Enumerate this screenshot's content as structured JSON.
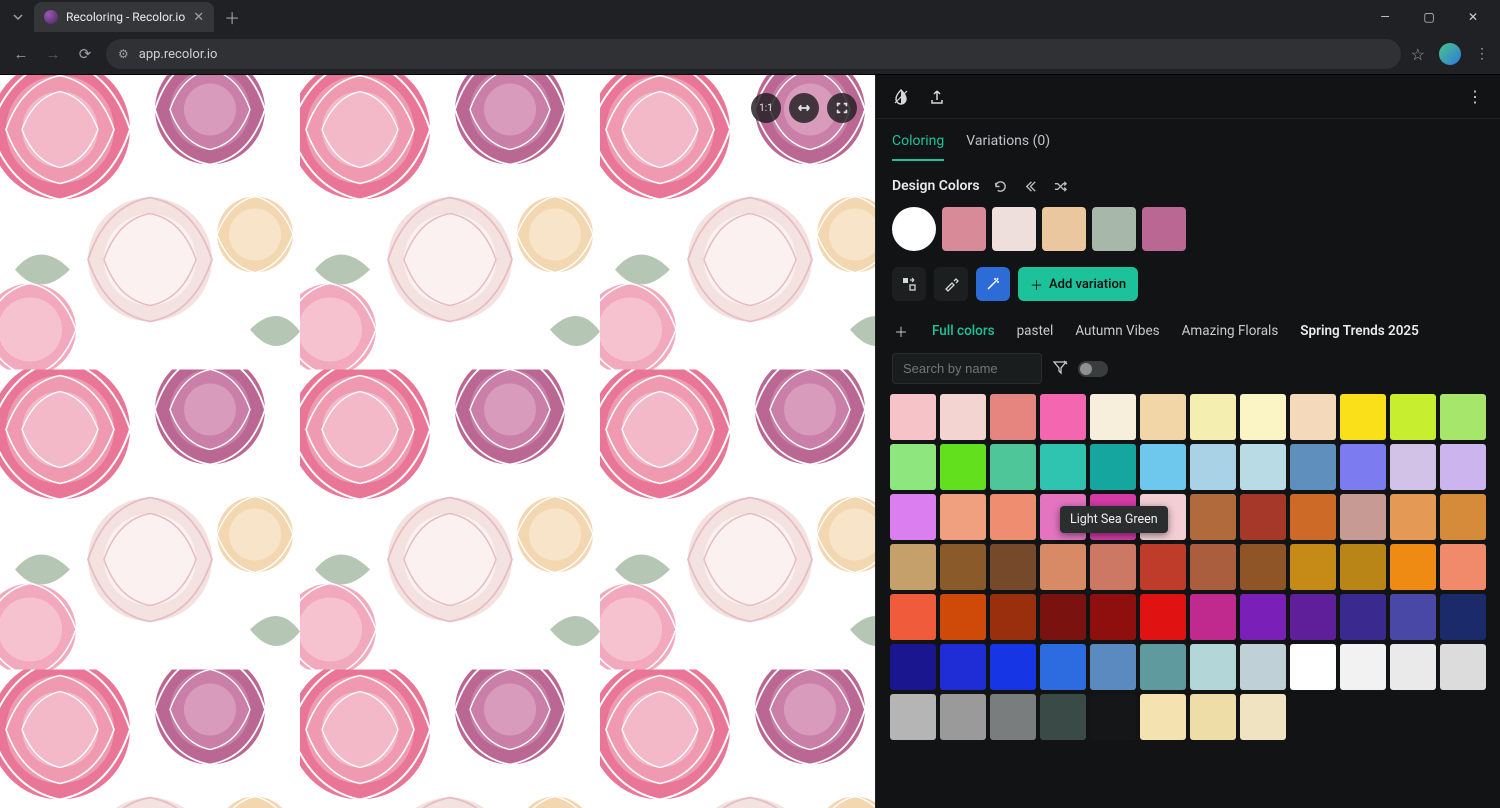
{
  "browser": {
    "tab_title": "Recoloring - Recolor.io",
    "url": "app.recolor.io"
  },
  "canvas": {
    "zoom_label": "1:1"
  },
  "panel": {
    "tabs": {
      "coloring": "Coloring",
      "variations": "Variations (0)"
    },
    "design_colors_title": "Design Colors",
    "design_colors": [
      "#ffffff",
      "#d98a99",
      "#eedfdc",
      "#ebc7a0",
      "#a7b8ab",
      "#bb6794"
    ],
    "add_variation_label": "Add variation",
    "palette_tabs": {
      "full_colors": "Full colors",
      "pastel": "pastel",
      "autumn": "Autumn Vibes",
      "florals": "Amazing Florals",
      "spring": "Spring Trends 2025"
    },
    "search_placeholder": "Search by name",
    "tooltip_text": "Light Sea Green",
    "palette": [
      "#f6c3c9",
      "#f3d4d1",
      "#e6857f",
      "#f566b1",
      "#f7efdc",
      "#f3d6a7",
      "#f5eeb1",
      "#fbf4c5",
      "#f4dabb",
      "#f9e018",
      "#c7ef2f",
      "#a6e66a",
      "#8ee67e",
      "#62e01e",
      "#4fc59a",
      "#2fc4b0",
      "#16a6a0",
      "#6ec7ec",
      "#a9d2e6",
      "#b9dbe6",
      "#5f8fbd",
      "#7d7bf0",
      "#d3c2e8",
      "#ccb4ef",
      "#da7ef0",
      "#f0a07f",
      "#ee8d6f",
      "#e474c0",
      "#d43aa5",
      "#f3cfd5",
      "#b06a3c",
      "#a53829",
      "#cd6a28",
      "#c79a93",
      "#e49a55",
      "#d58b3a",
      "#c6a06a",
      "#8a5a2a",
      "#75492a",
      "#d88a66",
      "#cd7765",
      "#bf3c2a",
      "#ab5e3d",
      "#8f5526",
      "#c68a17",
      "#b88516",
      "#ef8a12",
      "#f08a6a",
      "#ef5b3b",
      "#cf4908",
      "#9a2f0e",
      "#7a1210",
      "#8f0f0f",
      "#e01212",
      "#c02a8f",
      "#7a1fb8",
      "#5f1f9b",
      "#3a2a8f",
      "#4a48a6",
      "#1a2a6b",
      "#1a1690",
      "#1f2dd6",
      "#1636e6",
      "#2c6be0",
      "#5a8abf",
      "#5f9a9e",
      "#b3d6d8",
      "#bfd0d6",
      "#ffffff",
      "#f2f2f2",
      "#eaeaea",
      "#dcdcdc",
      "#b5b5b5",
      "#9a9a9a",
      "#7a7d7e",
      "#3a4a46",
      "#151617",
      "#f4e3b1",
      "#efdda8",
      "#f0e3c2"
    ]
  }
}
